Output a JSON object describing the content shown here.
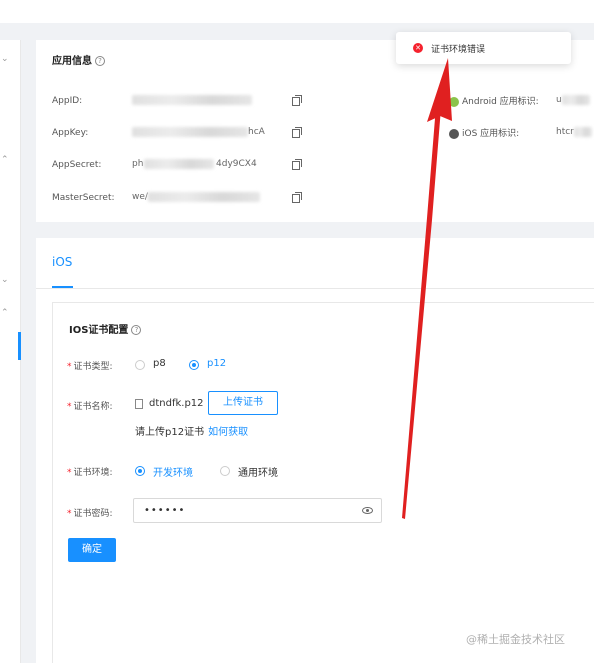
{
  "toast": {
    "icon": "error-icon",
    "message": "证书环境错误"
  },
  "app_info": {
    "title": "应用信息",
    "rows": [
      {
        "label": "AppID:",
        "value_suffix": ""
      },
      {
        "label": "AppKey:",
        "value_suffix": "hcA"
      },
      {
        "label": "AppSecret:",
        "value_prefix": "ph",
        "value_suffix": "4dy9CX4"
      },
      {
        "label": "MasterSecret:",
        "value_prefix": "we/"
      }
    ],
    "platforms": [
      {
        "label": "Android 应用标识:",
        "value": "u"
      },
      {
        "label": "iOS 应用标识:",
        "value": "htcr"
      }
    ]
  },
  "tabs": [
    {
      "label": "iOS",
      "active": true
    }
  ],
  "ios_config": {
    "title": "IOS证书配置",
    "cert_type": {
      "label": "证书类型:",
      "options": [
        "p8",
        "p12"
      ],
      "selected": "p12"
    },
    "cert_name": {
      "label": "证书名称:",
      "file": "dtndfk.p12",
      "upload_label": "上传证书",
      "hint": "请上传p12证书",
      "hint_link": "如何获取"
    },
    "cert_env": {
      "label": "证书环境:",
      "options": [
        "开发环境",
        "通用环境"
      ],
      "selected": "开发环境"
    },
    "cert_password": {
      "label": "证书密码:",
      "value": "••••••"
    },
    "confirm_label": "确定"
  },
  "watermark": "@稀土掘金技术社区",
  "colors": {
    "accent": "#1890ff",
    "error": "#f5222d",
    "arrow": "#e02020"
  }
}
